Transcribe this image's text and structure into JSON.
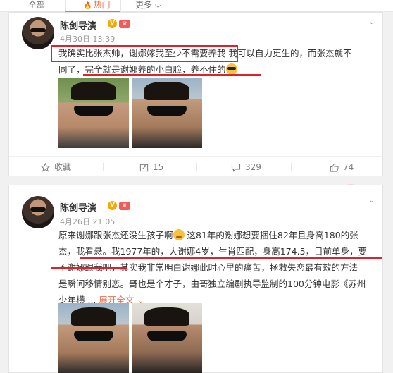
{
  "tabs": {
    "all": "全部",
    "hot": "热门",
    "more": "更多"
  },
  "posts": [
    {
      "author": "陈剑导演",
      "time": "4月30日 13:39",
      "text_lines": [
        [
          "我确实比张杰帅，谢娜嫁我至少不需要养我",
          " 我可以自力更生的，而张杰就不"
        ],
        [
          "同了，",
          "完全就是谢娜养的小白脸，养不住的"
        ]
      ],
      "actions": {
        "favorite": "收藏",
        "repost": "15",
        "comment": "329",
        "like": "74"
      }
    },
    {
      "author": "陈剑导演",
      "time": "4月26日 21:05",
      "text_lines": [
        "原来谢娜跟张杰还没生孩子啊",
        " 这81年的谢娜想要捆住82年且身高180的张",
        "杰，我看悬。我1977年的，大谢娜4岁，生肖匹配，身高174.5，目前单身，要",
        "不谢娜跟我吧，其实我非常明白谢娜此时心里的痛苦，拯救失恋最有效的方法",
        "是瞬间移情别恋。哥也是个才子，由哥独立编剧执导监制的100分钟电影《苏州",
        "少年横 ...",
        "展开全文"
      ]
    }
  ],
  "colors": {
    "accent": "#eb7350",
    "highlight": "#d9232d",
    "verified": "#f7a900"
  }
}
